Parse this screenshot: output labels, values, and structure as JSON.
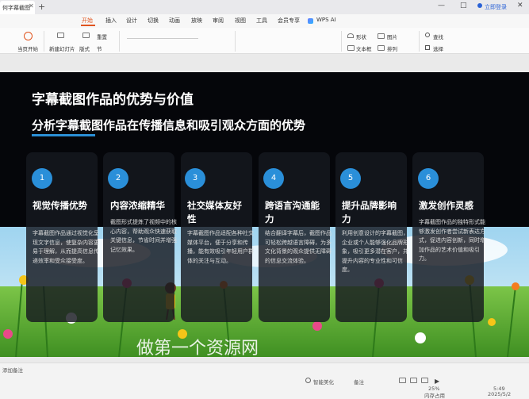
{
  "titlebar": {
    "doc_tab": "何字幕截图",
    "close": "✕",
    "new_tab": "+",
    "login": "立即登录",
    "minimize": "—",
    "maximize": "□",
    "close_window": "✕"
  },
  "menu": {
    "items": [
      "开始",
      "插入",
      "设计",
      "切换",
      "动画",
      "放映",
      "审阅",
      "视图",
      "工具",
      "会员专享",
      "WPS AI"
    ],
    "active_index": 0
  },
  "ribbon": {
    "from_start": "当页开始",
    "new_slide": "新建幻灯片",
    "layout": "版式",
    "section": "节",
    "reset": "重置",
    "shape": "形状",
    "image": "图片",
    "textbox": "文本框",
    "arrange": "排列",
    "find": "查找",
    "select": "选择"
  },
  "slide": {
    "title": "字幕截图作品的优势与价值",
    "subtitle": "分析字幕截图作品在传播信息和吸引观众方面的优势",
    "watermark": "做第一个资源网",
    "accent_color": "#2a8fd9",
    "cards": [
      {
        "num": "1",
        "title": "视觉传播优势",
        "body": "字幕截图作品通过视觉化呈现文字信息，使复杂内容更易于理解，从而提高信息传递效率和受众接受度。"
      },
      {
        "num": "2",
        "title": "内容浓缩精华",
        "body": "截图形式提炼了视频中的核心内容，帮助观众快速获取关键信息，节省时间并增强记忆效果。"
      },
      {
        "num": "3",
        "title": "社交媒体友好性",
        "body": "字幕截图作品适配各种社交媒体平台，便于分享和传播，能有效吸引年轻用户群体的关注与互动。"
      },
      {
        "num": "4",
        "title": "跨语言沟通能力",
        "body": "结合翻译字幕后，截图作品可轻松跨越语言障碍，为多文化背景的观众提供无障碍的信息交流体验。"
      },
      {
        "num": "5",
        "title": "提升品牌影响力",
        "body": "利用创意设计的字幕截图，企业或个人能够强化品牌形象，吸引更多潜在客户，并提升内容的专业性和可信度。"
      },
      {
        "num": "6",
        "title": "激发创作灵感",
        "body": "字幕截图作品的独特形式能够激发创作者尝试新表达方式，促进内容创新，同时增加作品的艺术价值和吸引力。"
      }
    ]
  },
  "status": {
    "notes_placeholder": "添加备注",
    "smart_beautify": "智能美化",
    "notes": "备注",
    "zoom": "25%",
    "memory": "内存占用",
    "time": "5:49",
    "date": "2025/5/2"
  }
}
